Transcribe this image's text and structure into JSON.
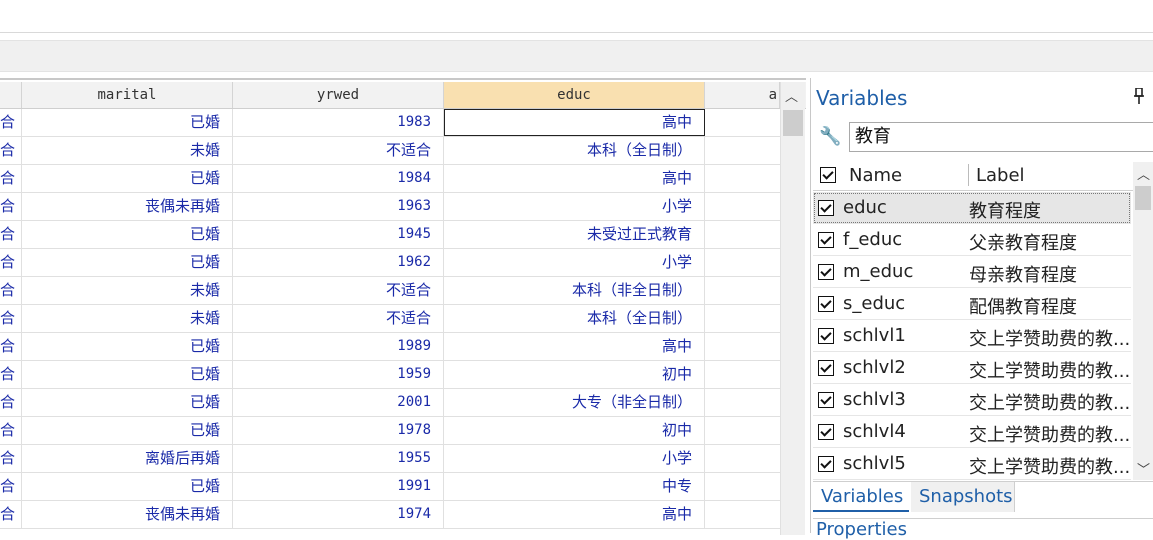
{
  "grid": {
    "columns": [
      {
        "key": "prev",
        "label": ""
      },
      {
        "key": "marital",
        "label": "marital"
      },
      {
        "key": "yrwed",
        "label": "yrwed"
      },
      {
        "key": "educ",
        "label": "educ"
      },
      {
        "key": "next",
        "label": "a"
      }
    ],
    "rows": [
      {
        "prev": "合",
        "marital": "已婚",
        "yrwed": "1983",
        "educ": "高中"
      },
      {
        "prev": "合",
        "marital": "未婚",
        "yrwed": "不适合",
        "educ": "本科（全日制）"
      },
      {
        "prev": "合",
        "marital": "已婚",
        "yrwed": "1984",
        "educ": "高中"
      },
      {
        "prev": "合",
        "marital": "丧偶未再婚",
        "yrwed": "1963",
        "educ": "小学"
      },
      {
        "prev": "合",
        "marital": "已婚",
        "yrwed": "1945",
        "educ": "未受过正式教育"
      },
      {
        "prev": "合",
        "marital": "已婚",
        "yrwed": "1962",
        "educ": "小学"
      },
      {
        "prev": "合",
        "marital": "未婚",
        "yrwed": "不适合",
        "educ": "本科（非全日制）"
      },
      {
        "prev": "合",
        "marital": "未婚",
        "yrwed": "不适合",
        "educ": "本科（全日制）"
      },
      {
        "prev": "合",
        "marital": "已婚",
        "yrwed": "1989",
        "educ": "高中"
      },
      {
        "prev": "合",
        "marital": "已婚",
        "yrwed": "1959",
        "educ": "初中"
      },
      {
        "prev": "合",
        "marital": "已婚",
        "yrwed": "2001",
        "educ": "大专（非全日制）"
      },
      {
        "prev": "合",
        "marital": "已婚",
        "yrwed": "1978",
        "educ": "初中"
      },
      {
        "prev": "合",
        "marital": "离婚后再婚",
        "yrwed": "1955",
        "educ": "小学"
      },
      {
        "prev": "合",
        "marital": "已婚",
        "yrwed": "1991",
        "educ": "中专"
      },
      {
        "prev": "合",
        "marital": "丧偶未再婚",
        "yrwed": "1974",
        "educ": "高中"
      }
    ]
  },
  "variables_panel": {
    "title": "Variables",
    "search_value": "教育",
    "col_name": "Name",
    "col_label": "Label",
    "items": [
      {
        "name": "educ",
        "label": "教育程度",
        "selected": true
      },
      {
        "name": "f_educ",
        "label": "父亲教育程度"
      },
      {
        "name": "m_educ",
        "label": "母亲教育程度"
      },
      {
        "name": "s_educ",
        "label": "配偶教育程度"
      },
      {
        "name": "schlvl1",
        "label": "交上学赞助费的教..."
      },
      {
        "name": "schlvl2",
        "label": "交上学赞助费的教..."
      },
      {
        "name": "schlvl3",
        "label": "交上学赞助费的教..."
      },
      {
        "name": "schlvl4",
        "label": "交上学赞助费的教..."
      },
      {
        "name": "schlvl5",
        "label": "交上学赞助费的教..."
      }
    ],
    "tabs": [
      "Variables",
      "Snapshots"
    ],
    "properties_title": "Properties"
  },
  "colors": {
    "accent": "#1f5fa8",
    "cell_text": "#1a2aa8",
    "selected_header": "#f9e0b0"
  }
}
